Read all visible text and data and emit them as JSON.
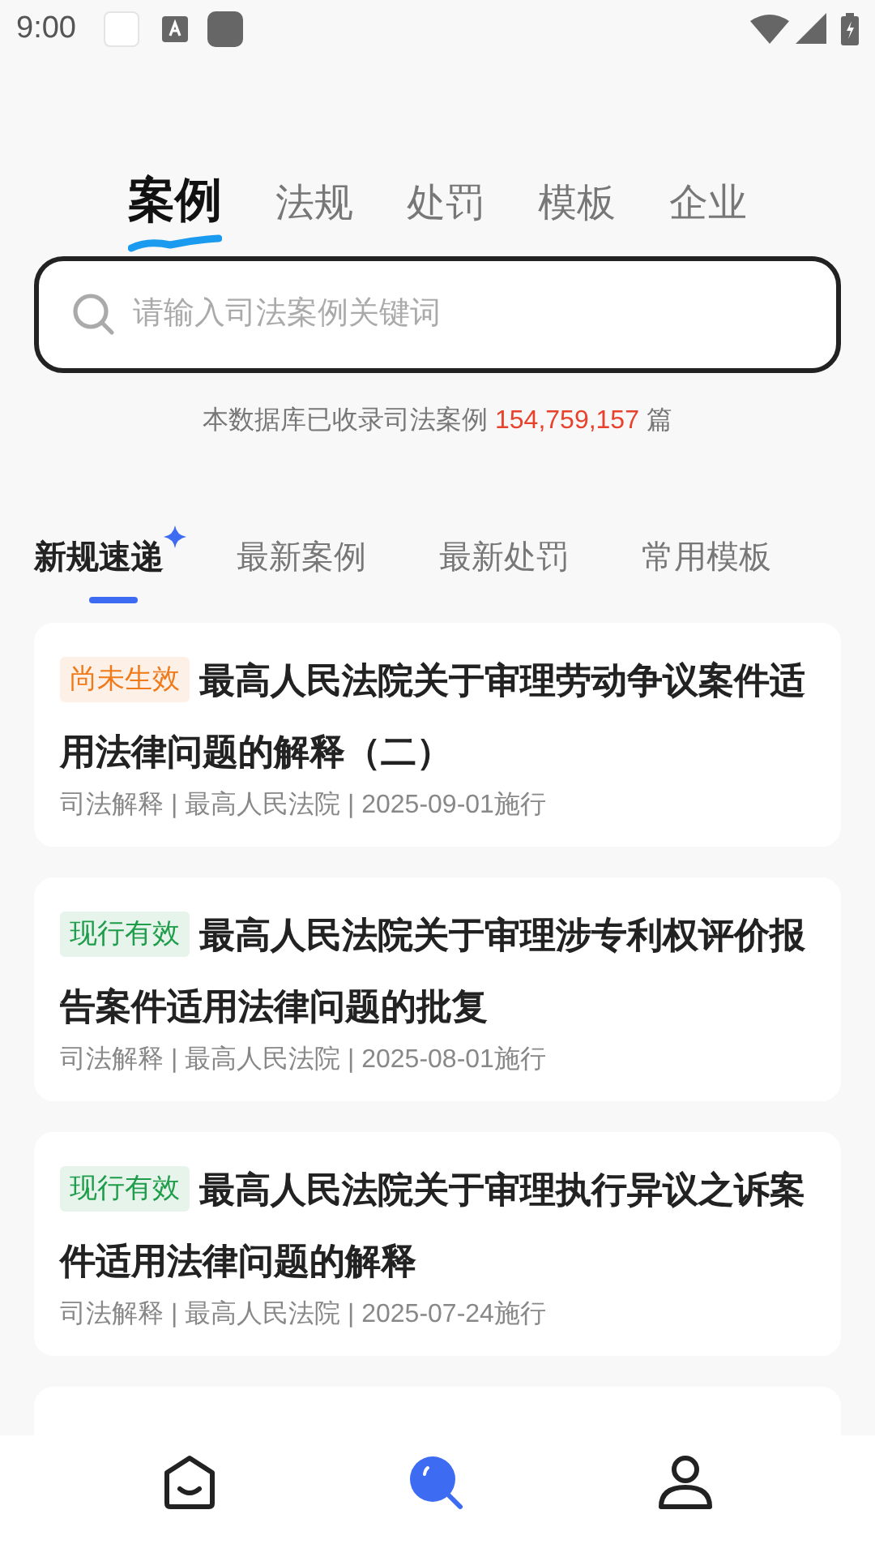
{
  "status_bar": {
    "time": "9:00"
  },
  "top_tabs": [
    {
      "label": "案例",
      "selected": true
    },
    {
      "label": "法规",
      "selected": false
    },
    {
      "label": "处罚",
      "selected": false
    },
    {
      "label": "模板",
      "selected": false
    },
    {
      "label": "企业",
      "selected": false
    }
  ],
  "search": {
    "placeholder": "请输入司法案例关键词"
  },
  "stats": {
    "prefix": "本数据库已收录司法案例",
    "count": "154,759,157",
    "suffix": "篇"
  },
  "sub_tabs": [
    {
      "label": "新规速递",
      "selected": true,
      "badge": true
    },
    {
      "label": "最新案例",
      "selected": false,
      "badge": false
    },
    {
      "label": "最新处罚",
      "selected": false,
      "badge": false
    },
    {
      "label": "常用模板",
      "selected": false,
      "badge": false
    }
  ],
  "cards": [
    {
      "tag": "尚未生效",
      "color": "#f07a1a",
      "title": "最高人民法院关于审理劳动争议案件适用法律问题的解释（二）",
      "meta": "司法解释 | 最高人民法院 | 2025-09-01施行"
    },
    {
      "tag": "现行有效",
      "color": "#1f9d4b",
      "title": "最高人民法院关于审理涉专利权评价报告案件适用法律问题的批复",
      "meta": "司法解释 | 最高人民法院 | 2025-08-01施行"
    },
    {
      "tag": "现行有效",
      "color": "#1f9d4b",
      "title": "最高人民法院关于审理执行异议之诉案件适用法律问题的解释",
      "meta": "司法解释 | 最高人民法院 | 2025-07-24施行"
    }
  ],
  "bottom_nav": [
    {
      "kind": "home",
      "selected": false
    },
    {
      "kind": "search",
      "selected": true
    },
    {
      "kind": "profile",
      "selected": false
    }
  ]
}
